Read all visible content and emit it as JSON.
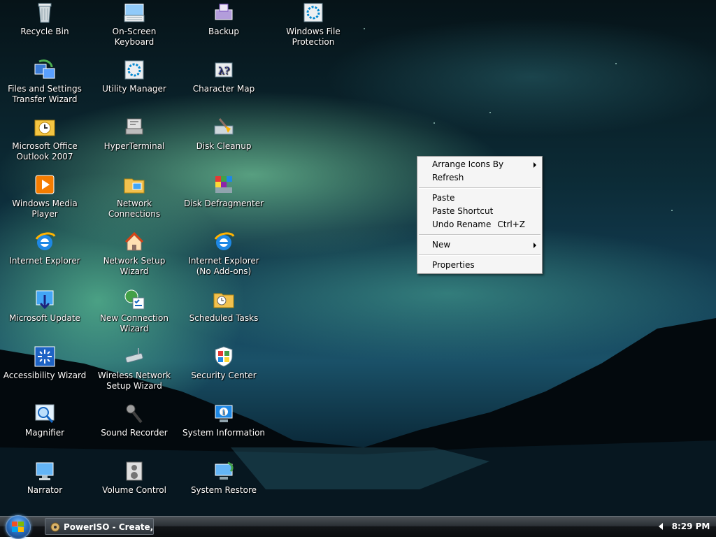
{
  "desktop": {
    "icons": [
      {
        "label": "Recycle Bin",
        "icon": "recycle-bin-icon"
      },
      {
        "label": "On-Screen Keyboard",
        "icon": "keyboard-icon"
      },
      {
        "label": "Backup",
        "icon": "backup-icon"
      },
      {
        "label": "Windows File Protection",
        "icon": "file-protection-icon"
      },
      {
        "label": "Files and Settings Transfer Wizard",
        "icon": "transfer-wizard-icon"
      },
      {
        "label": "Utility Manager",
        "icon": "utility-manager-icon"
      },
      {
        "label": "Character Map",
        "icon": "character-map-icon"
      },
      {
        "label": "Microsoft Office Outlook 2007",
        "icon": "outlook-icon"
      },
      {
        "label": "HyperTerminal",
        "icon": "hyperterminal-icon"
      },
      {
        "label": "Disk Cleanup",
        "icon": "disk-cleanup-icon"
      },
      {
        "label": "Windows Media Player",
        "icon": "media-player-icon"
      },
      {
        "label": "Network Connections",
        "icon": "network-connections-icon"
      },
      {
        "label": "Disk Defragmenter",
        "icon": "disk-defragmenter-icon"
      },
      {
        "label": "Internet Explorer",
        "icon": "internet-explorer-icon"
      },
      {
        "label": "Network Setup Wizard",
        "icon": "network-setup-icon"
      },
      {
        "label": "Internet Explorer (No Add-ons)",
        "icon": "internet-explorer-noaddons-icon"
      },
      {
        "label": "Microsoft Update",
        "icon": "microsoft-update-icon"
      },
      {
        "label": "New Connection Wizard",
        "icon": "new-connection-icon"
      },
      {
        "label": "Scheduled Tasks",
        "icon": "scheduled-tasks-icon"
      },
      {
        "label": "Accessibility Wizard",
        "icon": "accessibility-icon"
      },
      {
        "label": "Wireless Network Setup Wizard",
        "icon": "wireless-setup-icon"
      },
      {
        "label": "Security Center",
        "icon": "security-center-icon"
      },
      {
        "label": "Magnifier",
        "icon": "magnifier-icon"
      },
      {
        "label": "Sound Recorder",
        "icon": "sound-recorder-icon"
      },
      {
        "label": "System Information",
        "icon": "system-information-icon"
      },
      {
        "label": "Narrator",
        "icon": "narrator-icon"
      },
      {
        "label": "Volume Control",
        "icon": "volume-control-icon"
      },
      {
        "label": "System Restore",
        "icon": "system-restore-icon"
      }
    ]
  },
  "context_menu": {
    "arrange": "Arrange Icons By",
    "refresh": "Refresh",
    "paste": "Paste",
    "paste_shortcut": "Paste Shortcut",
    "undo_rename": "Undo Rename",
    "undo_shortcut": "Ctrl+Z",
    "new": "New",
    "properties": "Properties"
  },
  "taskbar": {
    "task_label": "PowerISO - Create, B...",
    "task_icon": "poweriso-icon",
    "clock": "8:29 PM",
    "start_icon": "windows-logo-icon",
    "tray_icon": "chevron-left-icon"
  },
  "colors": {
    "menu_bg": "#f5f5f5",
    "taskbar_dark": "#0b0d0f",
    "aurora_green": "#96ffbe"
  }
}
